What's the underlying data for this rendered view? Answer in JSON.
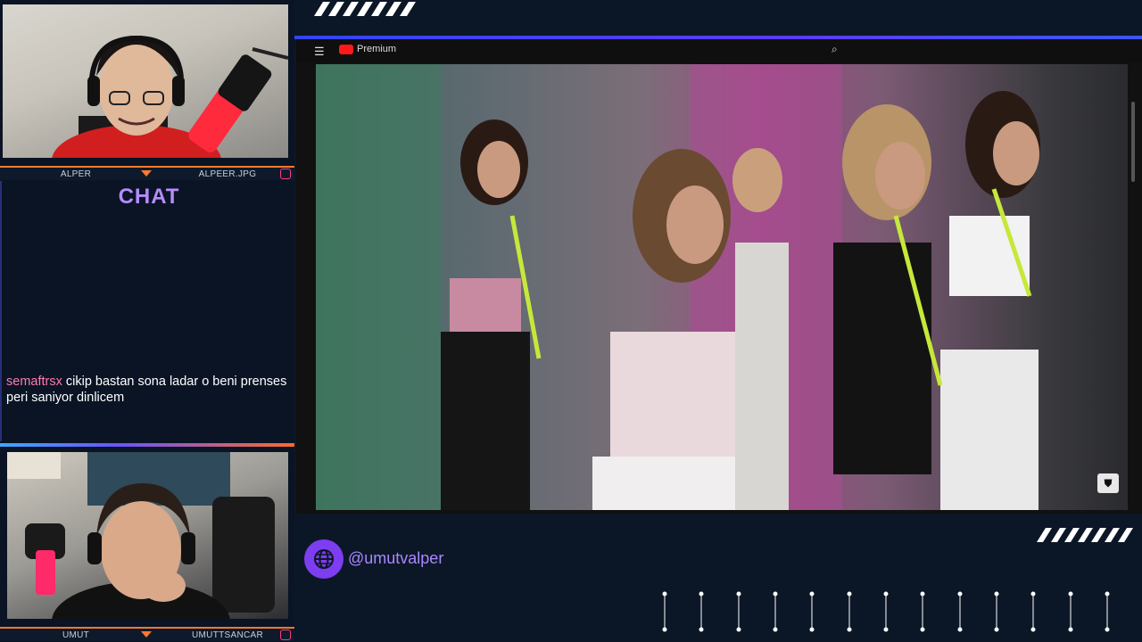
{
  "left_panel": {
    "top_cam": {
      "name_left": "ALPER",
      "name_right": "ALPEER.JPG"
    },
    "chat": {
      "title": "CHAT",
      "messages": [
        {
          "user": "semaftrsx",
          "text": "cikip bastan sona ladar o beni prenses peri saniyor dinlicem"
        }
      ]
    },
    "bottom_cam": {
      "name_left": "UMUT",
      "name_right": "UMUTTSANCAR"
    }
  },
  "video": {
    "player": "YouTube",
    "logo_text": "Premium"
  },
  "social": {
    "icon": "globe-icon",
    "handle": "@umutvalper"
  },
  "colors": {
    "background": "#0b1727",
    "chat_title": "#b58cff",
    "chat_user": "#ff7ab0",
    "accent_orange": "#ff7a2a",
    "accent_purple": "#7d3df0",
    "accent_blue": "#3344ff"
  }
}
